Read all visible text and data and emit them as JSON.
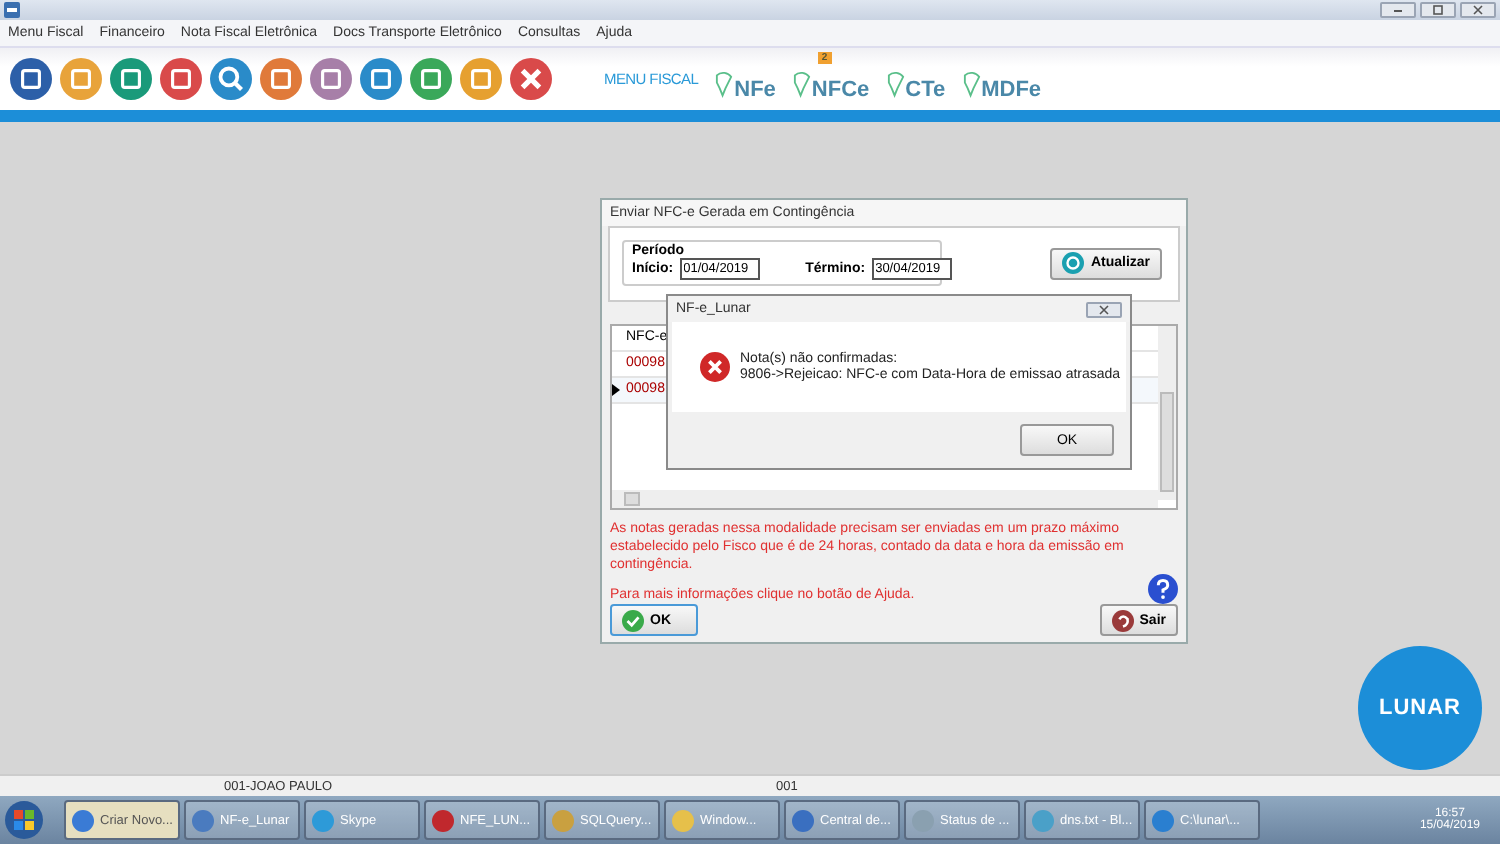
{
  "menu": [
    "Menu Fiscal",
    "Financeiro",
    "Nota Fiscal Eletrônica",
    "Docs Transporte Eletrônico",
    "Consultas",
    "Ajuda"
  ],
  "toolbar": {
    "caption": "MENU FISCAL",
    "modules": [
      {
        "label": "NFe"
      },
      {
        "label": "NFCe",
        "badge": "2"
      },
      {
        "label": "CTe"
      },
      {
        "label": "MDFe"
      }
    ]
  },
  "dialog": {
    "title": "Enviar NFC-e Gerada em Contingência",
    "period": {
      "legend": "Período",
      "start_label": "Início:",
      "start": "01/04/2019",
      "end_label": "Término:",
      "end": "30/04/2019"
    },
    "refresh_button": "Atualizar",
    "table": {
      "columns": [
        "NFC-e"
      ],
      "rows": [
        {
          "cells": [
            "00098"
          ],
          "selected": false
        },
        {
          "cells": [
            "00098"
          ],
          "selected": true
        }
      ]
    },
    "notice": "As notas geradas nessa modalidade precisam ser enviadas em um prazo máximo estabelecido pelo Fisco que é de 24 horas, contado da data e hora da emissão em contingência.",
    "help_text": "Para mais informações clique no botão de Ajuda.",
    "ok_button": "OK",
    "exit_button": "Sair"
  },
  "message_box": {
    "title": "NF-e_Lunar",
    "heading": "Nota(s) não confirmadas:",
    "detail": "9806->Rejeicao: NFC-e com Data-Hora de emissao atrasada",
    "ok_button": "OK"
  },
  "logo": "LUNAR",
  "status_bar": [
    "001-JOAO PAULO",
    "001"
  ],
  "taskbar": {
    "items": [
      {
        "label": "Criar Novo...",
        "selected": true
      },
      {
        "label": "NF-e_Lunar",
        "selected": false
      },
      {
        "label": "Skype",
        "selected": false
      },
      {
        "label": "NFE_LUN...",
        "selected": false
      },
      {
        "label": "SQLQuery...",
        "selected": false
      },
      {
        "label": "Window...",
        "selected": false
      },
      {
        "label": "Central de...",
        "selected": false
      },
      {
        "label": "Status de ...",
        "selected": false
      },
      {
        "label": "dns.txt - Bl...",
        "selected": false
      },
      {
        "label": "C:\\lunar\\...",
        "selected": false
      }
    ],
    "time": "16:57",
    "date": "15/04/2019"
  }
}
